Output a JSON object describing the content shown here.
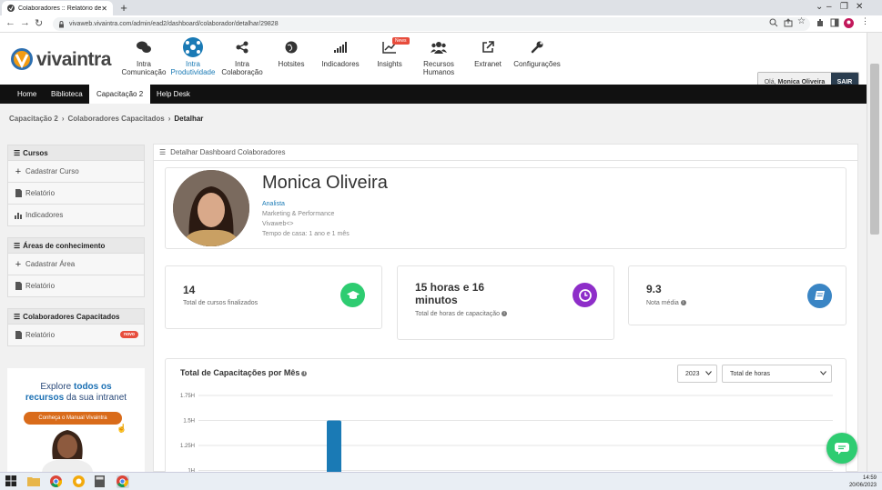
{
  "browser": {
    "tab_title": "Colaboradores :: Relatório de Co",
    "url": "vivaweb.vivaintra.com/admin/ead2/dashboard/colaborador/detalhar/29828"
  },
  "header": {
    "logo_text": "vivaintra",
    "menu": [
      {
        "label": "Intra Comunicação",
        "icon": "chat-icon"
      },
      {
        "label": "Intra Produtividade",
        "icon": "network-icon"
      },
      {
        "label": "Intra Colaboração",
        "icon": "share-icon"
      },
      {
        "label": "Hotsites",
        "icon": "globe-icon"
      },
      {
        "label": "Indicadores",
        "icon": "signal-icon"
      },
      {
        "label": "Insights",
        "icon": "line-chart-icon",
        "badge": "News"
      },
      {
        "label": "Recursos Humanos",
        "icon": "users-icon"
      },
      {
        "label": "Extranet",
        "icon": "external-link-icon"
      },
      {
        "label": "Configurações",
        "icon": "wrench-icon"
      }
    ],
    "greeting": "Olá,",
    "user_name": "Monica Oliveira",
    "logout": "SAIR"
  },
  "navbar": [
    "Home",
    "Biblioteca",
    "Capacitação 2",
    "Help Desk"
  ],
  "breadcrumb": [
    "Capacitação 2",
    "Colaboradores Capacitados",
    "Detalhar"
  ],
  "sidebar": {
    "cursos": {
      "title": "Cursos",
      "items": [
        "Cadastrar Curso",
        "Relatório",
        "Indicadores"
      ]
    },
    "areas": {
      "title": "Áreas de conhecimento",
      "items": [
        "Cadastrar Área",
        "Relatório"
      ]
    },
    "colab": {
      "title": "Colaboradores Capacitados",
      "items": [
        "Relatório"
      ],
      "badge": "novo"
    },
    "promo": {
      "line1_a": "Explore",
      "line1_b": "todos os",
      "line2_a": "recursos",
      "line2_b": "da sua intranet",
      "button": "Conheça o Manual Vivaintra"
    }
  },
  "main": {
    "header": "Detalhar Dashboard Colaboradores",
    "profile": {
      "name": "Monica Oliveira",
      "role": "Analista",
      "department": "Marketing & Performance",
      "company": "Vivaweb<>",
      "tenure": "Tempo de casa: 1 ano e 1 mês"
    },
    "stats": [
      {
        "value": "14",
        "label": "Total de cursos finalizados",
        "color": "#2ecc71"
      },
      {
        "value": "15 horas e 16 minutos",
        "label": "Total de horas de capacitação",
        "color": "#8e2ec9"
      },
      {
        "value": "9.3",
        "label": "Nota média",
        "color": "#3a85c4"
      }
    ],
    "chart": {
      "title": "Total de Capacitações por Mês",
      "year": "2023",
      "metric": "Total de horas"
    }
  },
  "chart_data": {
    "type": "bar",
    "yticks": [
      "1.75H",
      "1.5H",
      "1.25H",
      "1H"
    ],
    "ylim": [
      1,
      1.75
    ],
    "values": [
      1.5
    ],
    "color": "#1a7ab5"
  },
  "taskbar": {
    "time": "14:59",
    "date": "20/06/2023"
  }
}
